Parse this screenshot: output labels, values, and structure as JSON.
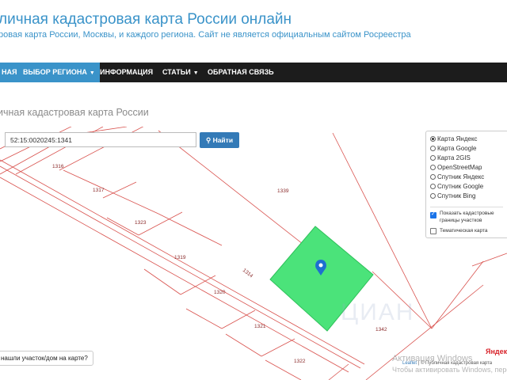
{
  "site": {
    "title": "личная кадастровая карта России онлайн",
    "subtitle": "ровая карта России, Москвы, и каждого региона. Сайт не является официальным сайтом Росреестра"
  },
  "nav": {
    "items": [
      {
        "label": "НАЯ"
      },
      {
        "label": "ВЫБОР РЕГИОНА"
      },
      {
        "label": "ИНФОРМАЦИЯ"
      },
      {
        "label": "СТАТЬИ"
      },
      {
        "label": "ОБРАТНАЯ СВЯЗЬ"
      }
    ]
  },
  "page": {
    "heading": "ичная кадастровая карта России"
  },
  "search": {
    "value": "52:15:0020245:1341",
    "button_label": "Найти"
  },
  "layers": {
    "options": [
      {
        "label": "Карта Яндекс",
        "selected": true
      },
      {
        "label": "Карта Google",
        "selected": false
      },
      {
        "label": "Карта 2GIS",
        "selected": false
      },
      {
        "label": "OpenStreetMap",
        "selected": false
      },
      {
        "label": "Спутник Яндекс",
        "selected": false
      },
      {
        "label": "Спутник Google",
        "selected": false
      },
      {
        "label": "Спутник Bing",
        "selected": false
      }
    ],
    "show_borders_label_1": "Показать кадастровые",
    "show_borders_label_2": "границы участков",
    "show_borders_checked": true,
    "thematic_label": "Тематическая карта",
    "thematic_checked": false
  },
  "parcels": {
    "labels": [
      "1316",
      "1317",
      "1323",
      "1319",
      "1320",
      "1321",
      "1322",
      "1339",
      "1314",
      "1342"
    ]
  },
  "map": {
    "help_text": "нашли участок/дом на карте?",
    "attribution_leaflet": "Leaflet",
    "attribution_rest": "| © Публичная кадастровая карта",
    "yandex_logo": "Яндекс",
    "watermark": "ЦИАН"
  },
  "os_overlay": {
    "activation_title": "Активация Windows",
    "activation_text": "Чтобы активировать Windows, перейд"
  },
  "colors": {
    "accent": "#3a93c9",
    "navbar": "#1c1c1c",
    "parcel_line": "#d9534f",
    "parcel_fill": "#4be37a",
    "button": "#337ab7"
  }
}
